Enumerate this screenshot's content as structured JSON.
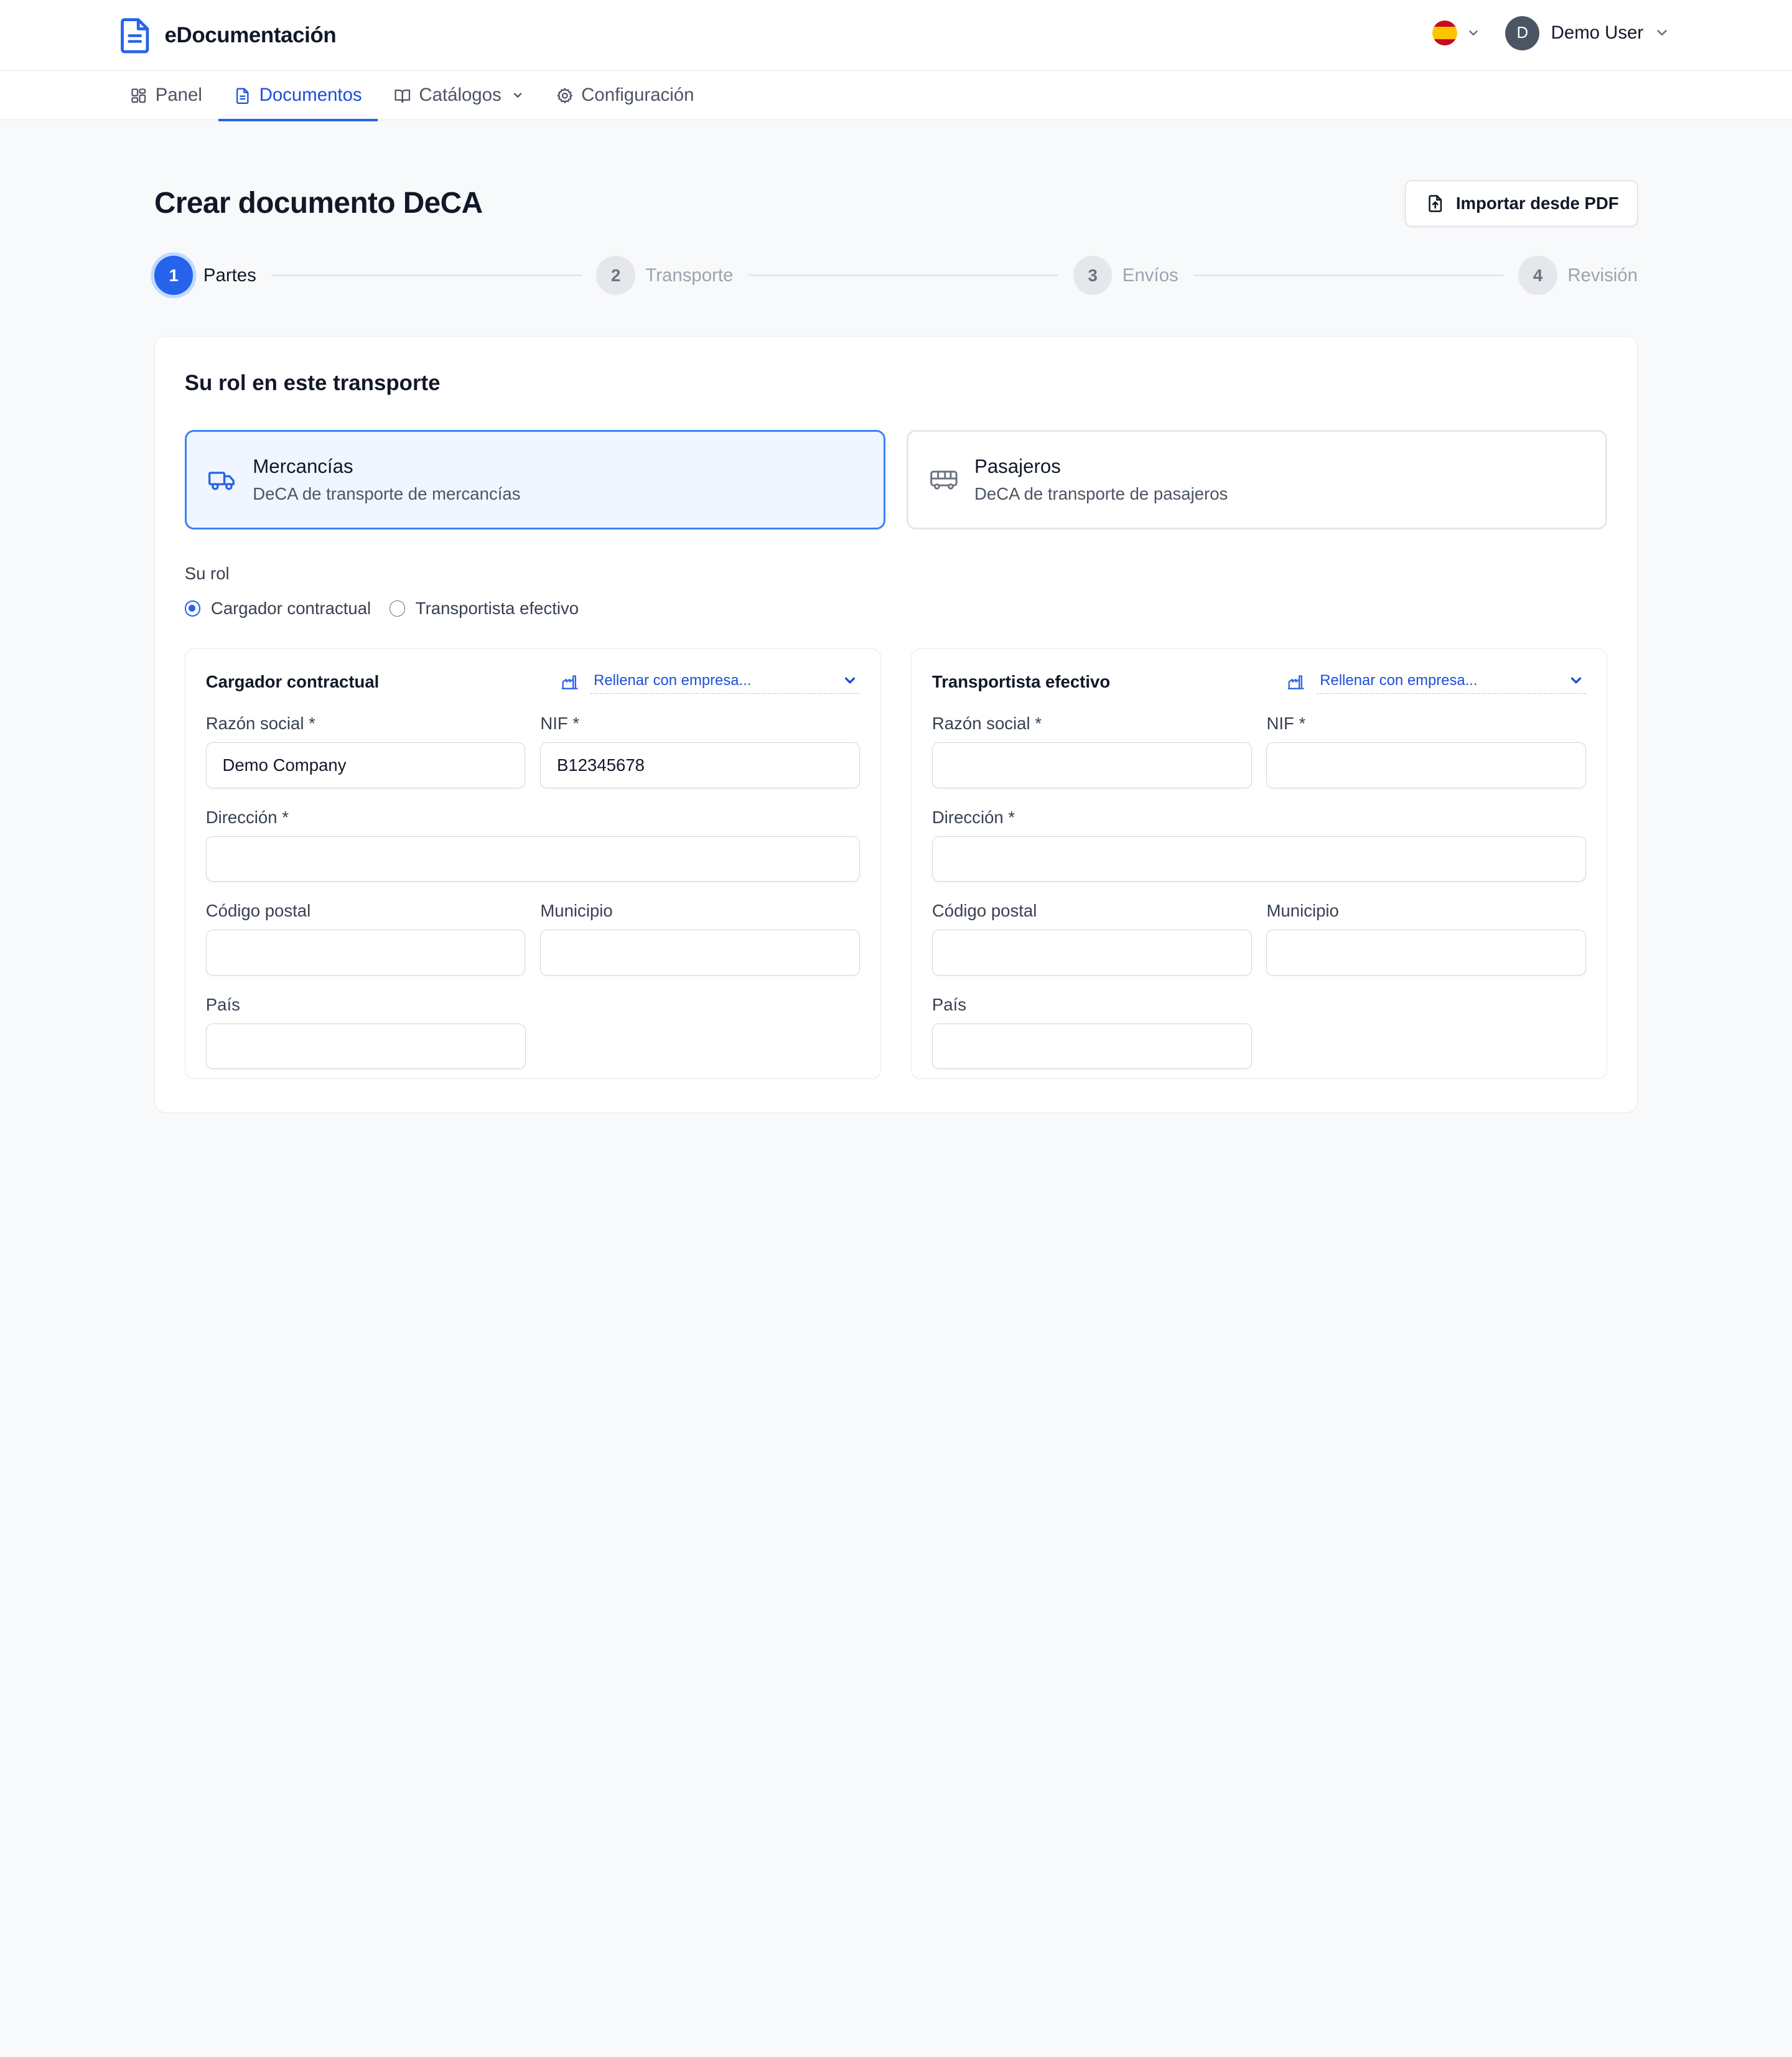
{
  "app": {
    "name": "eDocumentación"
  },
  "header": {
    "language": "es",
    "user": {
      "initial": "D",
      "name": "Demo User"
    }
  },
  "nav": {
    "items": [
      {
        "label": "Panel",
        "icon": "dashboard-icon"
      },
      {
        "label": "Documentos",
        "icon": "document-icon",
        "active": true
      },
      {
        "label": "Catálogos",
        "icon": "book-icon",
        "dropdown": true
      },
      {
        "label": "Configuración",
        "icon": "gear-icon"
      }
    ]
  },
  "page": {
    "title": "Crear documento DeCA",
    "import_button": "Importar desde PDF"
  },
  "stepper": {
    "steps": [
      {
        "num": "1",
        "label": "Partes",
        "active": true
      },
      {
        "num": "2",
        "label": "Transporte"
      },
      {
        "num": "3",
        "label": "Envíos"
      },
      {
        "num": "4",
        "label": "Revisión"
      }
    ]
  },
  "card": {
    "title": "Su rol en este transporte",
    "types": [
      {
        "title": "Mercancías",
        "desc": "DeCA de transporte de mercancías",
        "icon": "truck-icon",
        "selected": true
      },
      {
        "title": "Pasajeros",
        "desc": "DeCA de transporte de pasajeros",
        "icon": "bus-icon",
        "selected": false
      }
    ],
    "role_label": "Su rol",
    "roles": [
      {
        "label": "Cargador contractual",
        "checked": true
      },
      {
        "label": "Transportista efectivo",
        "checked": false
      }
    ]
  },
  "parties": [
    {
      "title": "Cargador contractual",
      "fill_label": "Rellenar con empresa...",
      "labels": {
        "razon": "Razón social *",
        "nif": "NIF *",
        "direccion": "Dirección *",
        "cp": "Código postal",
        "municipio": "Municipio",
        "pais": "País"
      },
      "values": {
        "razon": "Demo Company",
        "nif": "B12345678",
        "direccion": "",
        "cp": "",
        "municipio": "",
        "pais": ""
      }
    },
    {
      "title": "Transportista efectivo",
      "fill_label": "Rellenar con empresa...",
      "labels": {
        "razon": "Razón social *",
        "nif": "NIF *",
        "direccion": "Dirección *",
        "cp": "Código postal",
        "municipio": "Municipio",
        "pais": "País"
      },
      "values": {
        "razon": "",
        "nif": "",
        "direccion": "",
        "cp": "",
        "municipio": "",
        "pais": ""
      }
    }
  ],
  "colors": {
    "accent": "#2563eb",
    "selected_bg": "#eff6ff",
    "page_bg": "#f8f9fa"
  }
}
